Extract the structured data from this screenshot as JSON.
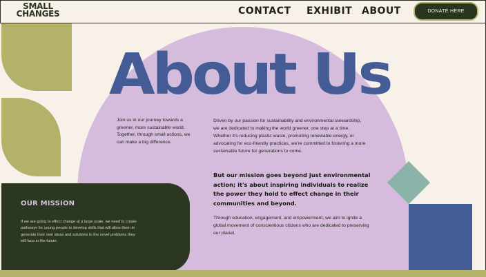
{
  "header": {
    "logo": [
      "SMALL",
      "CHANGES"
    ],
    "nav": [
      "CONTACT",
      "EXHIBIT",
      "ABOUT"
    ],
    "donate_label": "DONATE HERE"
  },
  "hero": {
    "title": "About Us"
  },
  "content": {
    "intro": "Join us in our journey towards a greener, more sustainable world. Together, through small actions, we can make a big difference.",
    "para1": "Driven by our passion for sustainability and environmental stewardship, we are dedicated to making the world greener, one step at a time. Whether it's reducing plastic waste, promoting renewable energy, or advocating for eco-friendly practices, we're committed to fostering a more sustainable future for generations to come.",
    "highlight": "But our mission goes beyond just environmental action; it's about inspiring individuals to realize the power they hold to effect change in their communities and beyond.",
    "para2": "Through education, engagement, and empowerment, we aim to ignite a global movement of conscientious citizens who are dedicated to preserving our planet."
  },
  "mission": {
    "title": "OUR MISSION",
    "text": "If we are going to effect change at a large scale, we need to create pathways for young people to develop skills that will allow them to generate their own ideas and solutions to the novel problems they will face in the future."
  },
  "colors": {
    "background": "#f8f1e9",
    "lavender": "#d5bcdc",
    "blue": "#455b95",
    "olive": "#b3b16a",
    "dark_green": "#2b3721",
    "sage": "#8bb3a9"
  }
}
